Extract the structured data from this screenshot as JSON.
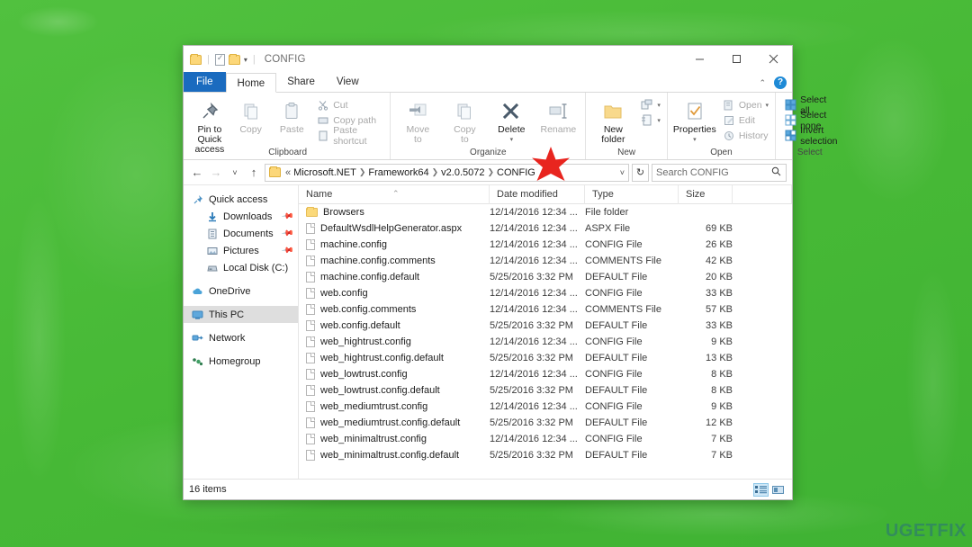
{
  "desktop": {
    "background_color": "#4cbe3b"
  },
  "watermark": {
    "text": "UGETFIX"
  },
  "window": {
    "title": "CONFIG",
    "quick_access": {
      "folder_label": "folder-icon",
      "properties_label": "properties-icon",
      "new_folder_label": "new-folder-icon",
      "customize_label": "▾"
    },
    "controls": {
      "minimize": "–",
      "maximize": "▢",
      "close": "✕",
      "collapse_ribbon": "^",
      "help": "?"
    }
  },
  "tabs": [
    {
      "id": "file",
      "label": "File"
    },
    {
      "id": "home",
      "label": "Home"
    },
    {
      "id": "share",
      "label": "Share"
    },
    {
      "id": "view",
      "label": "View"
    }
  ],
  "ribbon": {
    "groups": [
      {
        "name": "clipboard",
        "label": "Clipboard",
        "big_buttons": [
          {
            "name": "pin-to-quick-access",
            "label": "Pin to Quick\naccess",
            "line1": "Pin to Quick",
            "line2": "access",
            "dim": false
          },
          {
            "name": "copy",
            "label": "Copy",
            "line1": "Copy",
            "line2": "",
            "dim": true
          },
          {
            "name": "paste",
            "label": "Paste",
            "line1": "Paste",
            "line2": "",
            "dim": true
          }
        ],
        "small_buttons": [
          {
            "name": "cut",
            "label": "Cut",
            "dim": true
          },
          {
            "name": "copy-path",
            "label": "Copy path",
            "dim": true
          },
          {
            "name": "paste-shortcut",
            "label": "Paste shortcut",
            "dim": true
          }
        ]
      },
      {
        "name": "organize",
        "label": "Organize",
        "big_buttons": [
          {
            "name": "move-to",
            "line1": "Move",
            "line2": "to",
            "dim": true,
            "caret": true
          },
          {
            "name": "copy-to",
            "line1": "Copy",
            "line2": "to",
            "dim": true,
            "caret": true
          },
          {
            "name": "delete",
            "line1": "Delete",
            "line2": "",
            "dim": false,
            "caret": true
          },
          {
            "name": "rename",
            "line1": "Rename",
            "line2": "",
            "dim": true,
            "caret": false
          }
        ],
        "small_buttons": []
      },
      {
        "name": "new",
        "label": "New",
        "big_buttons": [
          {
            "name": "new-folder",
            "line1": "New",
            "line2": "folder",
            "dim": false
          }
        ],
        "small_buttons": [
          {
            "name": "new-item",
            "label": "",
            "dim": false
          },
          {
            "name": "easy-access",
            "label": "",
            "dim": false
          }
        ]
      },
      {
        "name": "open",
        "label": "Open",
        "big_buttons": [
          {
            "name": "properties",
            "line1": "Properties",
            "line2": "",
            "dim": false,
            "caret": true
          }
        ],
        "small_buttons": [
          {
            "name": "open",
            "label": "Open",
            "dim": true,
            "caret": true
          },
          {
            "name": "edit",
            "label": "Edit",
            "dim": true
          },
          {
            "name": "history",
            "label": "History",
            "dim": true
          }
        ]
      },
      {
        "name": "select",
        "label": "Select",
        "big_buttons": [],
        "small_buttons": [
          {
            "name": "select-all",
            "label": "Select all",
            "dim": false
          },
          {
            "name": "select-none",
            "label": "Select none",
            "dim": false
          },
          {
            "name": "invert-selection",
            "label": "Invert selection",
            "dim": false
          }
        ]
      }
    ]
  },
  "address_bar": {
    "back": "←",
    "forward": "→",
    "recent": "˅",
    "up": "↑",
    "breadcrumbs": [
      "«",
      "Microsoft.NET",
      "Framework64",
      "v2.0.5072",
      "CONFIG"
    ],
    "dropdown_caret": "˅",
    "refresh": "↻"
  },
  "search": {
    "placeholder": "Search CONFIG",
    "value": "",
    "icon": "search-icon"
  },
  "sidebar": {
    "items": [
      {
        "name": "quick-access",
        "label": "Quick access",
        "level": 0,
        "icon": "pin-icon",
        "pinned": false,
        "selected": false
      },
      {
        "name": "downloads",
        "label": "Downloads",
        "level": 1,
        "icon": "download-icon",
        "pinned": true,
        "selected": false
      },
      {
        "name": "documents",
        "label": "Documents",
        "level": 1,
        "icon": "documents-icon",
        "pinned": true,
        "selected": false
      },
      {
        "name": "pictures",
        "label": "Pictures",
        "level": 1,
        "icon": "pictures-icon",
        "pinned": true,
        "selected": false
      },
      {
        "name": "local-disk-c",
        "label": "Local Disk (C:)",
        "level": 1,
        "icon": "drive-icon",
        "pinned": false,
        "selected": false
      },
      {
        "name": "onedrive",
        "label": "OneDrive",
        "level": 0,
        "icon": "cloud-icon",
        "pinned": false,
        "selected": false
      },
      {
        "name": "this-pc",
        "label": "This PC",
        "level": 0,
        "icon": "monitor-icon",
        "pinned": false,
        "selected": true
      },
      {
        "name": "network",
        "label": "Network",
        "level": 0,
        "icon": "network-icon",
        "pinned": false,
        "selected": false
      },
      {
        "name": "homegroup",
        "label": "Homegroup",
        "level": 0,
        "icon": "homegroup-icon",
        "pinned": false,
        "selected": false
      }
    ]
  },
  "file_list": {
    "columns": [
      {
        "name": "name",
        "label": "Name",
        "sorted": true,
        "sort_dir": "asc"
      },
      {
        "name": "date-modified",
        "label": "Date modified"
      },
      {
        "name": "type",
        "label": "Type"
      },
      {
        "name": "size",
        "label": "Size"
      }
    ],
    "rows": [
      {
        "name": "Browsers",
        "date": "12/14/2016 12:34 ...",
        "type": "File folder",
        "size": "",
        "icon": "folder-icon"
      },
      {
        "name": "DefaultWsdlHelpGenerator.aspx",
        "date": "12/14/2016 12:34 ...",
        "type": "ASPX File",
        "size": "69 KB",
        "icon": "file-icon"
      },
      {
        "name": "machine.config",
        "date": "12/14/2016 12:34 ...",
        "type": "CONFIG File",
        "size": "26 KB",
        "icon": "file-icon"
      },
      {
        "name": "machine.config.comments",
        "date": "12/14/2016 12:34 ...",
        "type": "COMMENTS File",
        "size": "42 KB",
        "icon": "file-icon"
      },
      {
        "name": "machine.config.default",
        "date": "5/25/2016 3:32 PM",
        "type": "DEFAULT File",
        "size": "20 KB",
        "icon": "file-icon"
      },
      {
        "name": "web.config",
        "date": "12/14/2016 12:34 ...",
        "type": "CONFIG File",
        "size": "33 KB",
        "icon": "file-icon"
      },
      {
        "name": "web.config.comments",
        "date": "12/14/2016 12:34 ...",
        "type": "COMMENTS File",
        "size": "57 KB",
        "icon": "file-icon"
      },
      {
        "name": "web.config.default",
        "date": "5/25/2016 3:32 PM",
        "type": "DEFAULT File",
        "size": "33 KB",
        "icon": "file-icon"
      },
      {
        "name": "web_hightrust.config",
        "date": "12/14/2016 12:34 ...",
        "type": "CONFIG File",
        "size": "9 KB",
        "icon": "file-icon"
      },
      {
        "name": "web_hightrust.config.default",
        "date": "5/25/2016 3:32 PM",
        "type": "DEFAULT File",
        "size": "13 KB",
        "icon": "file-icon"
      },
      {
        "name": "web_lowtrust.config",
        "date": "12/14/2016 12:34 ...",
        "type": "CONFIG File",
        "size": "8 KB",
        "icon": "file-icon"
      },
      {
        "name": "web_lowtrust.config.default",
        "date": "5/25/2016 3:32 PM",
        "type": "DEFAULT File",
        "size": "8 KB",
        "icon": "file-icon"
      },
      {
        "name": "web_mediumtrust.config",
        "date": "12/14/2016 12:34 ...",
        "type": "CONFIG File",
        "size": "9 KB",
        "icon": "file-icon"
      },
      {
        "name": "web_mediumtrust.config.default",
        "date": "5/25/2016 3:32 PM",
        "type": "DEFAULT File",
        "size": "12 KB",
        "icon": "file-icon"
      },
      {
        "name": "web_minimaltrust.config",
        "date": "12/14/2016 12:34 ...",
        "type": "CONFIG File",
        "size": "7 KB",
        "icon": "file-icon"
      },
      {
        "name": "web_minimaltrust.config.default",
        "date": "5/25/2016 3:32 PM",
        "type": "DEFAULT File",
        "size": "7 KB",
        "icon": "file-icon"
      }
    ]
  },
  "status_bar": {
    "item_count": "16 items",
    "view_details": "details-view-icon",
    "view_large_icons": "large-icons-view-icon"
  },
  "annotation": {
    "type": "red-star",
    "points_at": "New folder button",
    "color": "#e8251f"
  }
}
